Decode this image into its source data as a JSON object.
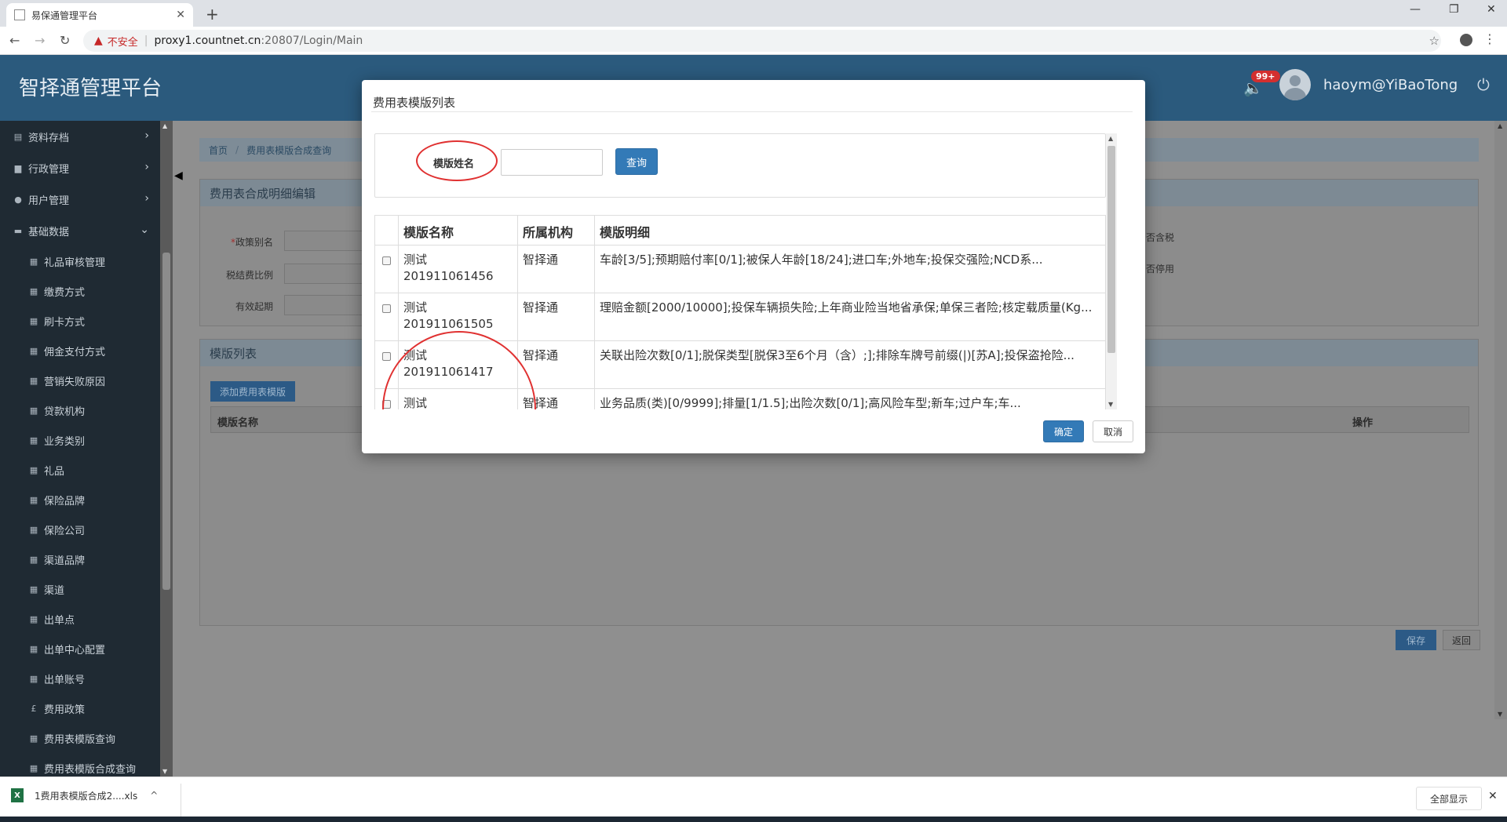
{
  "browser": {
    "tab_title": "易保通管理平台",
    "tab_close": "✕",
    "new_tab": "+",
    "min": "—",
    "max": "❐",
    "close": "✕",
    "back": "←",
    "forward": "→",
    "reload": "↻",
    "warning_icon": "▲",
    "insecure": "不安全",
    "separator": "|",
    "url_host": "proxy1.countnet.cn",
    "url_path": ":20807/Login/Main",
    "star": "☆",
    "kebab": "⋮"
  },
  "header": {
    "brand": "智择通管理平台",
    "notification_badge": "99+",
    "speaker_icon": "🔈",
    "username": "haoym@YiBaoTong",
    "power_icon": "⏻"
  },
  "sidebar": {
    "top_items": [
      {
        "label": "资料存档",
        "icon": "▤",
        "chevron": "›"
      },
      {
        "label": "行政管理",
        "icon": "▆",
        "chevron": "›"
      },
      {
        "label": "用户管理",
        "icon": "●",
        "chevron": "›"
      },
      {
        "label": "基础数据",
        "icon": "▬",
        "chevron": "⌄"
      }
    ],
    "sub_items": [
      {
        "label": "礼品审核管理",
        "icon": "▦"
      },
      {
        "label": "缴费方式",
        "icon": "▦"
      },
      {
        "label": "刷卡方式",
        "icon": "▦"
      },
      {
        "label": "佣金支付方式",
        "icon": "▦"
      },
      {
        "label": "营销失败原因",
        "icon": "▦"
      },
      {
        "label": "贷款机构",
        "icon": "▦"
      },
      {
        "label": "业务类别",
        "icon": "▦"
      },
      {
        "label": "礼品",
        "icon": "▦"
      },
      {
        "label": "保险品牌",
        "icon": "▦"
      },
      {
        "label": "保险公司",
        "icon": "▦"
      },
      {
        "label": "渠道品牌",
        "icon": "▦"
      },
      {
        "label": "渠道",
        "icon": "▦"
      },
      {
        "label": "出单点",
        "icon": "▦"
      },
      {
        "label": "出单中心配置",
        "icon": "▦"
      },
      {
        "label": "出单账号",
        "icon": "▦"
      },
      {
        "label": "费用政策",
        "icon": "£"
      },
      {
        "label": "费用表模版查询",
        "icon": "▦"
      },
      {
        "label": "费用表模版合成查询",
        "icon": "▦"
      }
    ]
  },
  "page": {
    "collapse_icon": "◀",
    "breadcrumb": [
      "首页",
      "费用表模版合成查询"
    ],
    "breadcrumb_sep": "/",
    "panel1_title": "费用表合成明细编辑",
    "fields": {
      "policy_alias": "政策别名",
      "tax_ratio": "税结费比例",
      "valid_from": "有效起期",
      "tax_included": "否含税",
      "disabled": "否停用",
      "required_mark": "*"
    },
    "panel2_title": "模版列表",
    "add_template_button": "添加费用表模版",
    "table_headers": {
      "name": "模版名称",
      "action": "操作"
    },
    "save_button": "保存",
    "back_button": "返回"
  },
  "modal": {
    "title": "费用表模版列表",
    "search_label": "模版姓名",
    "search_value": "",
    "query_button": "查询",
    "headers": [
      "模版名称",
      "所属机构",
      "模版明细"
    ],
    "rows": [
      {
        "name": "测试 201911061456",
        "org": "智择通",
        "detail": "车龄[3/5];预期赔付率[0/1];被保人年龄[18/24];进口车;外地车;投保交强险;NCD系..."
      },
      {
        "name": "测试 201911061505",
        "org": "智择通",
        "detail": "理赔金额[2000/10000];投保车辆损失险;上年商业险当地省承保;单保三者险;核定载质量(Kg..."
      },
      {
        "name": "测试 201911061417",
        "org": "智择通",
        "detail": "关联出险次数[0/1];脱保类型[脱保3至6个月（含）;];排除车牌号前缀(|)[苏A];投保盗抢险..."
      },
      {
        "name": "测试",
        "org": "智择通",
        "detail": "业务品质(类)[0/9999];排量[1/1.5];出险次数[0/1];高风险车型;新车;过户车;车..."
      }
    ],
    "ok_button": "确定",
    "cancel_button": "取消"
  },
  "download": {
    "filename": "1费用表模版合成2....xls",
    "xls_icon": "X",
    "chevron": "^",
    "show_all": "全部显示",
    "close": "✕"
  }
}
